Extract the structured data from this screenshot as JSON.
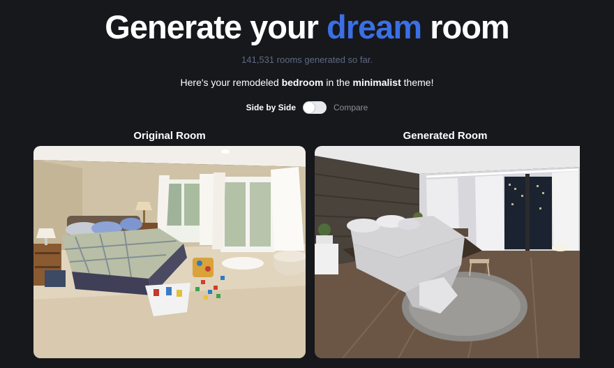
{
  "headline": {
    "before": "Generate your",
    "accent": "dream",
    "after": "room"
  },
  "counter": "141,531 rooms generated so far.",
  "summary": {
    "prefix": "Here's your remodeled",
    "room": "bedroom",
    "middle": "in the",
    "theme": "minimalist",
    "suffix": "theme!"
  },
  "view_toggle": {
    "left_label": "Side by Side",
    "right_label": "Compare",
    "state": "side-by-side"
  },
  "columns": {
    "original_title": "Original Room",
    "generated_title": "Generated Room"
  },
  "colors": {
    "background": "#17181c",
    "accent": "#3b6fe6",
    "counter": "#5d6b82"
  }
}
